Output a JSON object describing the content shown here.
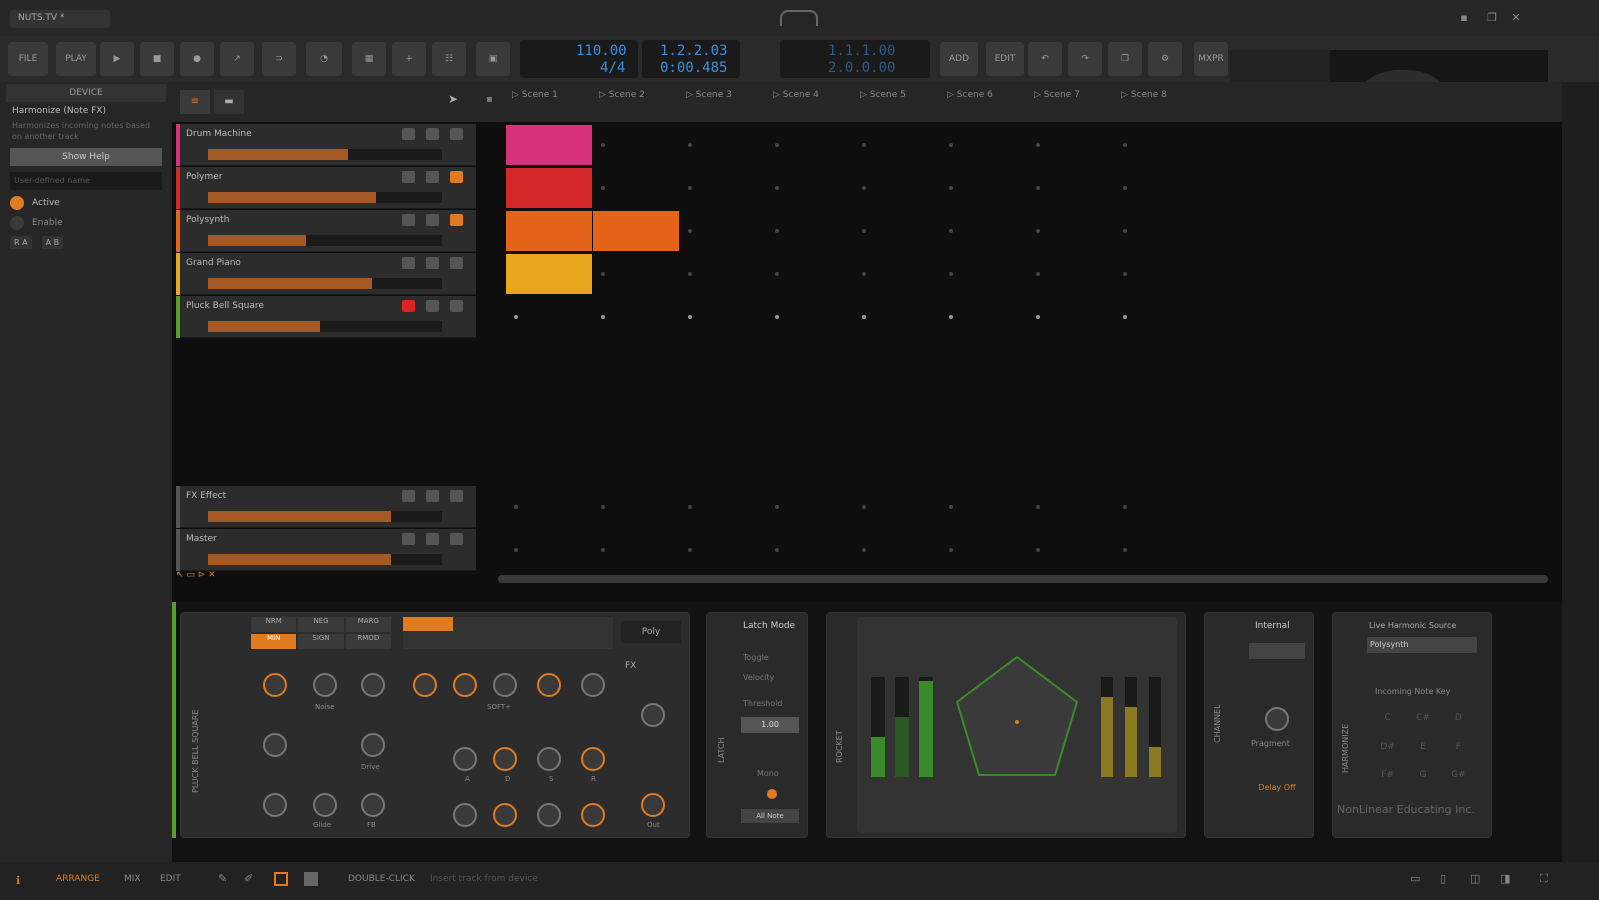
{
  "window": {
    "doc_tab": "NUTS.TV *",
    "controls": [
      "minimize",
      "restore",
      "close"
    ]
  },
  "toolbar": {
    "file": "FILE",
    "play_menu": "PLAY",
    "add": "ADD",
    "edit": "EDIT",
    "tempo": "110.00",
    "signature": "4/4",
    "position": "1.2.2.03",
    "time": "0:00.485",
    "loop_start": "1.1.1.00",
    "loop_end": "2.0.0.00",
    "right_label": "MXPR"
  },
  "device_panel": {
    "header": "DEVICE",
    "title": "Harmonize (Note FX)",
    "desc": "Harmonizes incoming notes based on another track",
    "show_help": "Show Help",
    "user_label_placeholder": "User-defined name",
    "active": "Active",
    "enable": "Enable",
    "page_a": "R A",
    "page_b": "A B"
  },
  "launcher": {
    "scenes": [
      "Scene 1",
      "Scene 2",
      "Scene 3",
      "Scene 4",
      "Scene 5",
      "Scene 6",
      "Scene 7",
      "Scene 8"
    ],
    "tracks": [
      {
        "name": "Drum Machine",
        "color": "#d6337a",
        "meter": 0.6
      },
      {
        "name": "Polymer",
        "color": "#d2282a",
        "meter": 0.72
      },
      {
        "name": "Polysynth",
        "color": "#e4641a",
        "meter": 0.42
      },
      {
        "name": "Grand Piano",
        "color": "#e8a81e",
        "meter": 0.7
      },
      {
        "name": "Pluck Bell Square",
        "color": "#5a9d2f",
        "meter": 0.48
      }
    ],
    "effect_tracks": [
      {
        "name": "FX Effect",
        "meter": 0.78
      },
      {
        "name": "Master",
        "meter": 0.78
      }
    ]
  },
  "devices": {
    "instrument_label": "PLUCK BELL SQUARE",
    "osc_buttons": [
      "NRM",
      "NEG",
      "MARG",
      "MIN",
      "SIGN",
      "RMOD"
    ],
    "knob_labels": [
      "Noise",
      "Drive",
      "Glide",
      "FB",
      "SOFT+",
      "A",
      "D",
      "S",
      "R",
      "Out"
    ],
    "poly": "Poly",
    "fx_button": "FX",
    "latch": {
      "title": "Latch Mode",
      "options": [
        "Toggle",
        "Velocity"
      ],
      "threshold": "Threshold",
      "value": "1.00",
      "mono": "Mono",
      "all_notes": "All Note",
      "label": "LATCH"
    },
    "note_fx_label": "ROCKET",
    "channel": {
      "title": "Internal",
      "amount": "Pragment",
      "delay": "Delay Off",
      "label": "CHANNEL"
    },
    "harmonize": {
      "source": "Live Harmonic Source",
      "track": "Polysynth",
      "incoming": "Incoming Note Key",
      "label": "HARMONIZE"
    },
    "watermark": "NonLinear Educating Inc."
  },
  "statusbar": {
    "arrange": "ARRANGE",
    "mix": "MIX",
    "edit": "EDIT",
    "hint_key": "DOUBLE-CLICK",
    "hint": "Insert track from device"
  }
}
